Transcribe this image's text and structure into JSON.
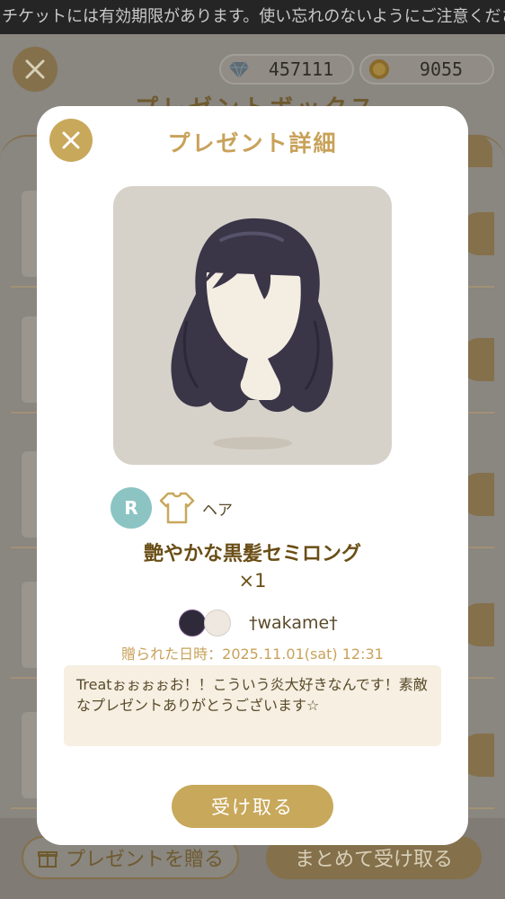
{
  "ticker": {
    "text": "チケットには有効期限があります。使い忘れのないようにご注意ください"
  },
  "currency": {
    "gems": {
      "value": "457111",
      "icon": "diamond-icon"
    },
    "coins": {
      "value": "9055",
      "icon": "coin-icon"
    }
  },
  "background": {
    "title": "プレゼントボックス",
    "send_label": "プレゼントを贈る",
    "receive_all_label": "まとめて受け取る"
  },
  "modal": {
    "title": "プレゼント詳細",
    "rarity": "R",
    "category": "ヘア",
    "item_name": "艶やかな黒髪セミロング",
    "quantity": "×1",
    "sender_name": "†wakame†",
    "date": "贈られた日時：2025.11.01(sat) 12:31",
    "message": "Treatぉぉぉぉお！！こういう炎大好きなんです！素敵なプレゼントありがとうございます☆",
    "receive_label": "受け取る"
  },
  "colors": {
    "accent": "#c8a85a",
    "rarity": "#8cc4c4",
    "message_bg": "#f6efe2",
    "overlay_bg": "#8a8680"
  }
}
